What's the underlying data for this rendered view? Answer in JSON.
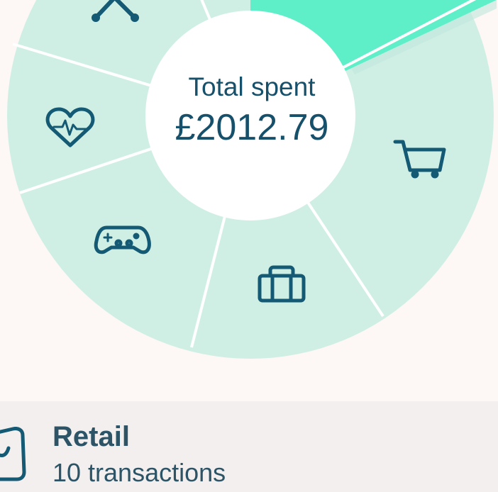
{
  "summary": {
    "total_label": "Total spent",
    "total_value": "£2012.79"
  },
  "chart_data": {
    "type": "pie",
    "style": "donut",
    "categories": [
      "tools-icon",
      "retail-icon",
      "luggage-icon",
      "gaming-icon",
      "health-icon",
      "unlabeled"
    ],
    "selected_category_icon": "tools-icon"
  },
  "selected_category": {
    "name": "Retail",
    "transactions": "10 transactions",
    "icon": "shopping-bag-icon"
  },
  "colors": {
    "background": "#fdf7f5",
    "segment": "#cfefe5",
    "selected_segment": "#5eeec8",
    "divider": "#ffffff",
    "icon": "#145a74",
    "panel": "#f3efee"
  }
}
